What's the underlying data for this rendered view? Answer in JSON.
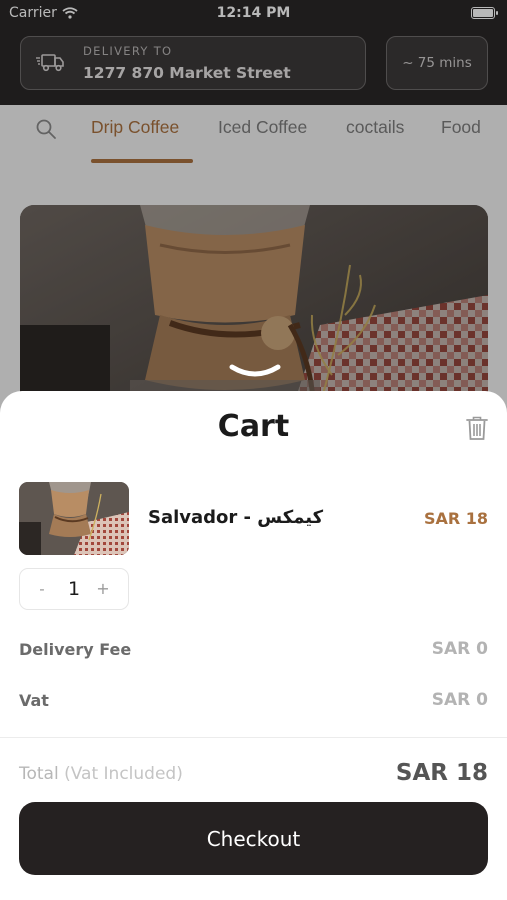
{
  "status_bar": {
    "carrier": "Carrier",
    "time": "12:14 PM"
  },
  "header": {
    "delivery_label": "DELIVERY TO",
    "delivery_address": "1277 870 Market Street",
    "eta": "~ 75 mins",
    "icons": {
      "delivery": "delivery-truck-icon",
      "wifi": "wifi-icon",
      "battery": "battery-icon"
    }
  },
  "categories": {
    "search_icon": "search-icon",
    "tabs": [
      {
        "label": "Drip Coffee",
        "active": true
      },
      {
        "label": "Iced Coffee",
        "active": false
      },
      {
        "label": "coctails",
        "active": false
      },
      {
        "label": "Food",
        "active": false
      }
    ]
  },
  "cart": {
    "title": "Cart",
    "items": [
      {
        "name": "Salvador - كيمكس",
        "price": "SAR 18",
        "quantity": "1",
        "minus": "-",
        "plus": "+"
      }
    ],
    "summary": [
      {
        "label": "Delivery Fee",
        "value": "SAR 0"
      },
      {
        "label": "Vat",
        "value": "SAR 0"
      }
    ],
    "total": {
      "label": "Total",
      "sub_label": "(Vat Included)",
      "value": "SAR 18"
    },
    "checkout_label": "Checkout"
  },
  "colors": {
    "accent": "#a9713f",
    "dark": "#252121",
    "header_bg": "#2a2727"
  }
}
